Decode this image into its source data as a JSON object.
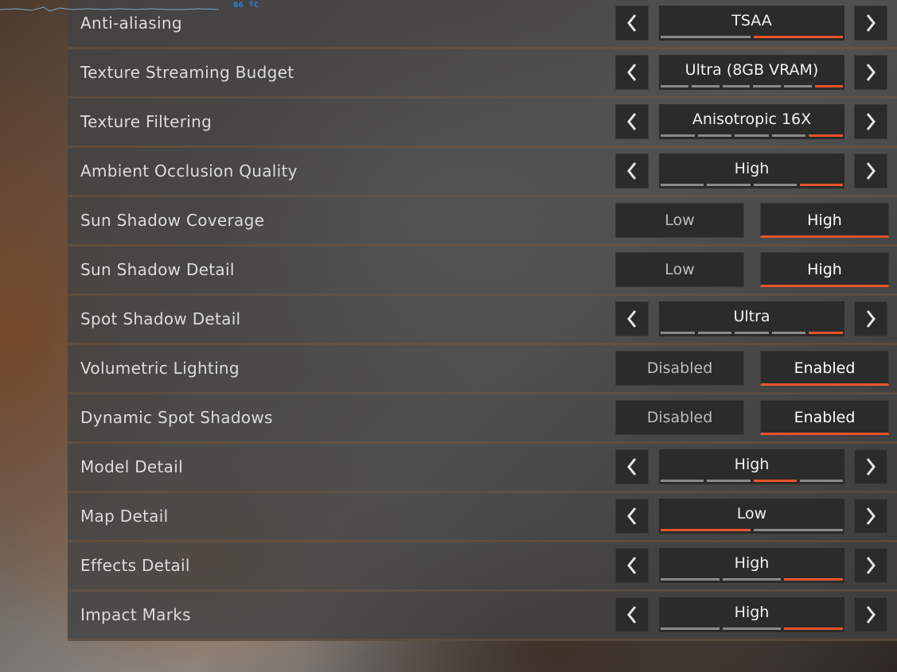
{
  "overlay": {
    "fps_text": "66 ºC"
  },
  "colors": {
    "accent": "#e8542c",
    "row_bg": "#424242",
    "control_bg": "#2b2b2b",
    "segment_inactive": "#8a8a8a"
  },
  "settings": [
    {
      "label": "Anti-aliasing",
      "type": "selector",
      "value": "TSAA",
      "segments": 2,
      "active_segment": 2
    },
    {
      "label": "Texture Streaming Budget",
      "type": "selector",
      "value": "Ultra (8GB VRAM)",
      "segments": 6,
      "active_segment": 6
    },
    {
      "label": "Texture Filtering",
      "type": "selector",
      "value": "Anisotropic 16X",
      "segments": 5,
      "active_segment": 5
    },
    {
      "label": "Ambient Occlusion Quality",
      "type": "selector",
      "value": "High",
      "segments": 4,
      "active_segment": 4
    },
    {
      "label": "Sun Shadow Coverage",
      "type": "toggle",
      "options": [
        "Low",
        "High"
      ],
      "selected": 1
    },
    {
      "label": "Sun Shadow Detail",
      "type": "toggle",
      "options": [
        "Low",
        "High"
      ],
      "selected": 1
    },
    {
      "label": "Spot Shadow Detail",
      "type": "selector",
      "value": "Ultra",
      "segments": 5,
      "active_segment": 5
    },
    {
      "label": "Volumetric Lighting",
      "type": "toggle",
      "options": [
        "Disabled",
        "Enabled"
      ],
      "selected": 1
    },
    {
      "label": "Dynamic Spot Shadows",
      "type": "toggle",
      "options": [
        "Disabled",
        "Enabled"
      ],
      "selected": 1
    },
    {
      "label": "Model Detail",
      "type": "selector",
      "value": "High",
      "segments": 4,
      "active_segment": 3
    },
    {
      "label": "Map Detail",
      "type": "selector",
      "value": "Low",
      "segments": 2,
      "active_segment": 1
    },
    {
      "label": "Effects Detail",
      "type": "selector",
      "value": "High",
      "segments": 3,
      "active_segment": 3
    },
    {
      "label": "Impact Marks",
      "type": "selector",
      "value": "High",
      "segments": 3,
      "active_segment": 3
    }
  ]
}
